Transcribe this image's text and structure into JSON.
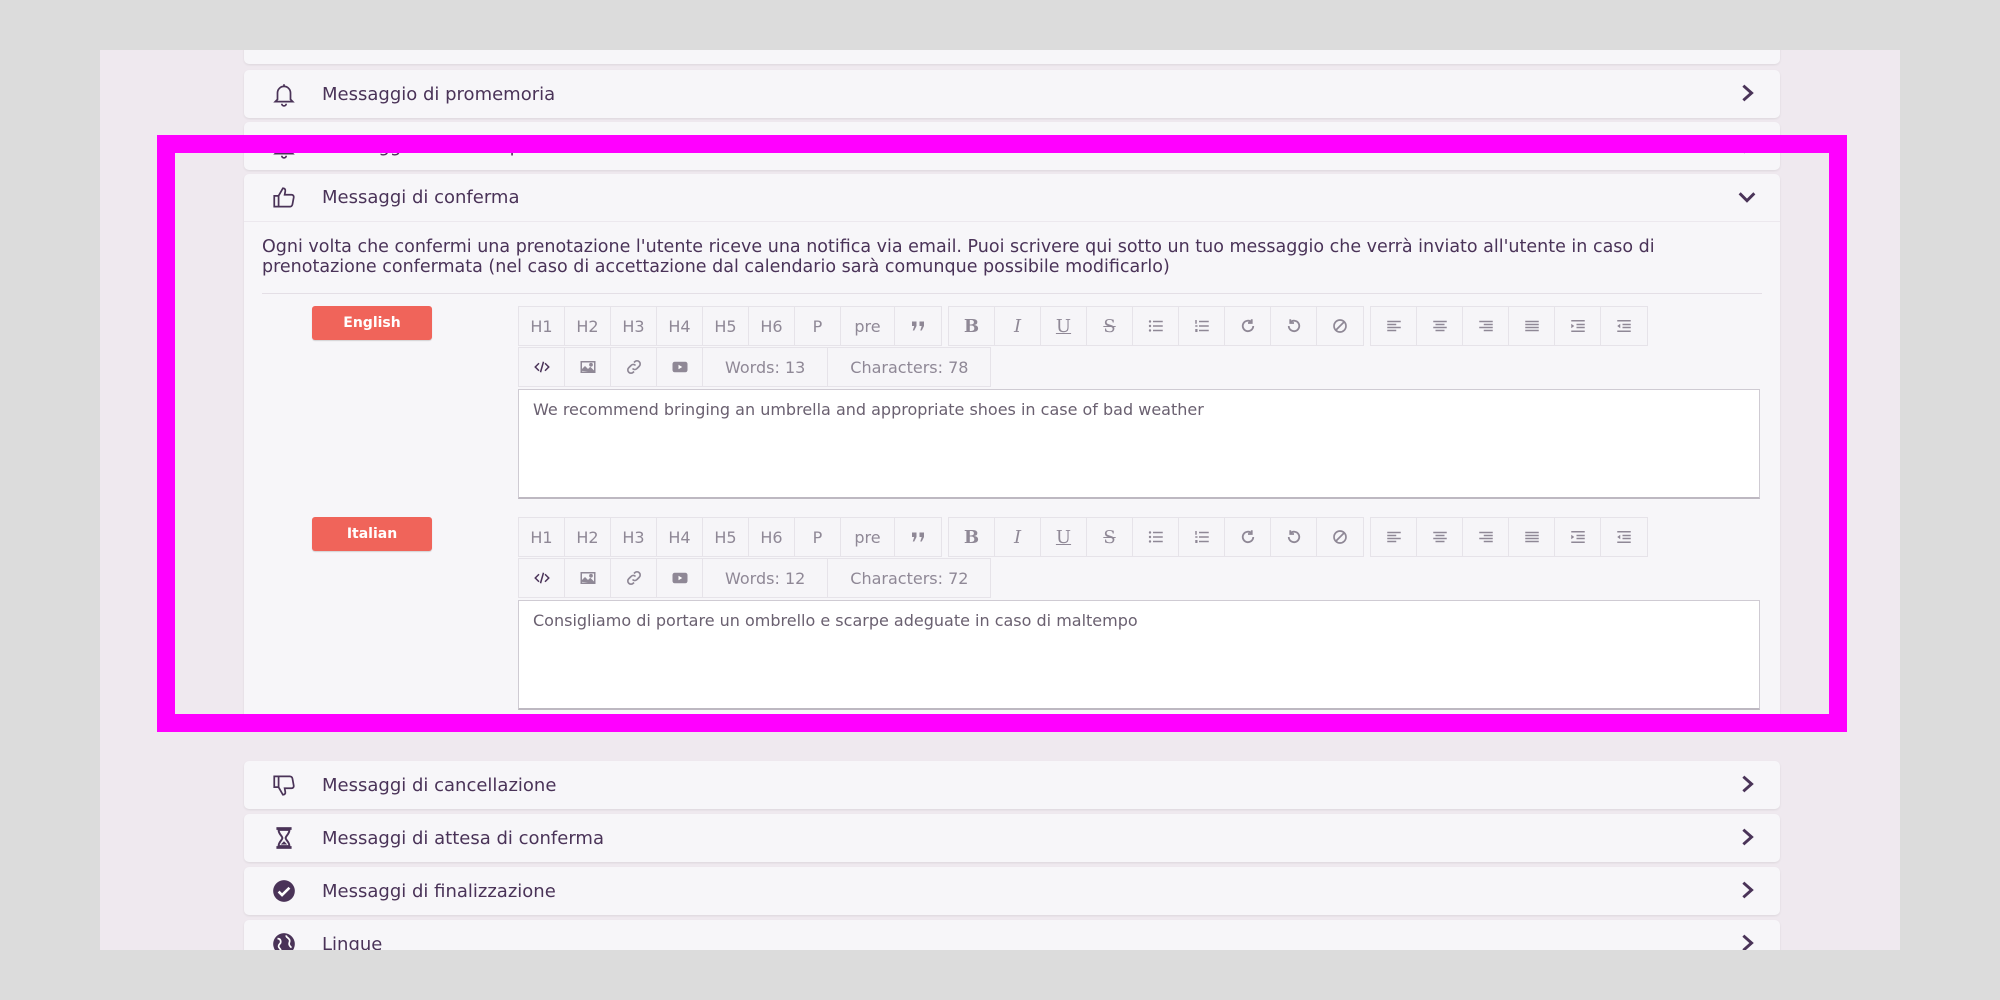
{
  "sections": {
    "reminder": {
      "title": "Messaggio di promemoria",
      "icon": "bell-icon"
    },
    "followup": {
      "title": "Messaggio di followup",
      "icon": "bell-icon"
    },
    "confirm": {
      "title": "Messaggi di conferma",
      "icon": "thumbs-up-icon",
      "description": "Ogni volta che confermi una prenotazione l'utente riceve una notifica via email. Puoi scrivere qui sotto un tuo messaggio che verrà inviato all'utente in caso di prenotazione confermata (nel caso di accettazione dal calendario sarà comunque possibile modificarlo)"
    },
    "cancel": {
      "title": "Messaggi di cancellazione",
      "icon": "thumbs-down-icon"
    },
    "waiting": {
      "title": "Messaggi di attesa di conferma",
      "icon": "hourglass-icon"
    },
    "finalize": {
      "title": "Messaggi di finalizzazione",
      "icon": "check-circle-icon"
    },
    "languages": {
      "title": "Lingue",
      "icon": "globe-icon"
    }
  },
  "toolbar": {
    "headings": [
      "H1",
      "H2",
      "H3",
      "H4",
      "H5",
      "H6",
      "P",
      "pre"
    ]
  },
  "editors": {
    "english": {
      "lang": "English",
      "words": "Words: 13",
      "characters": "Characters: 78",
      "content": "We recommend bringing an umbrella and appropriate shoes in case of bad weather"
    },
    "italian": {
      "lang": "Italian",
      "words": "Words: 12",
      "characters": "Characters: 72",
      "content": "Consigliamo di portare un ombrello e scarpe adeguate in caso di maltempo"
    }
  },
  "colors": {
    "accent": "#f0645a",
    "text": "#4a3358",
    "highlight": "#ff00ff"
  }
}
